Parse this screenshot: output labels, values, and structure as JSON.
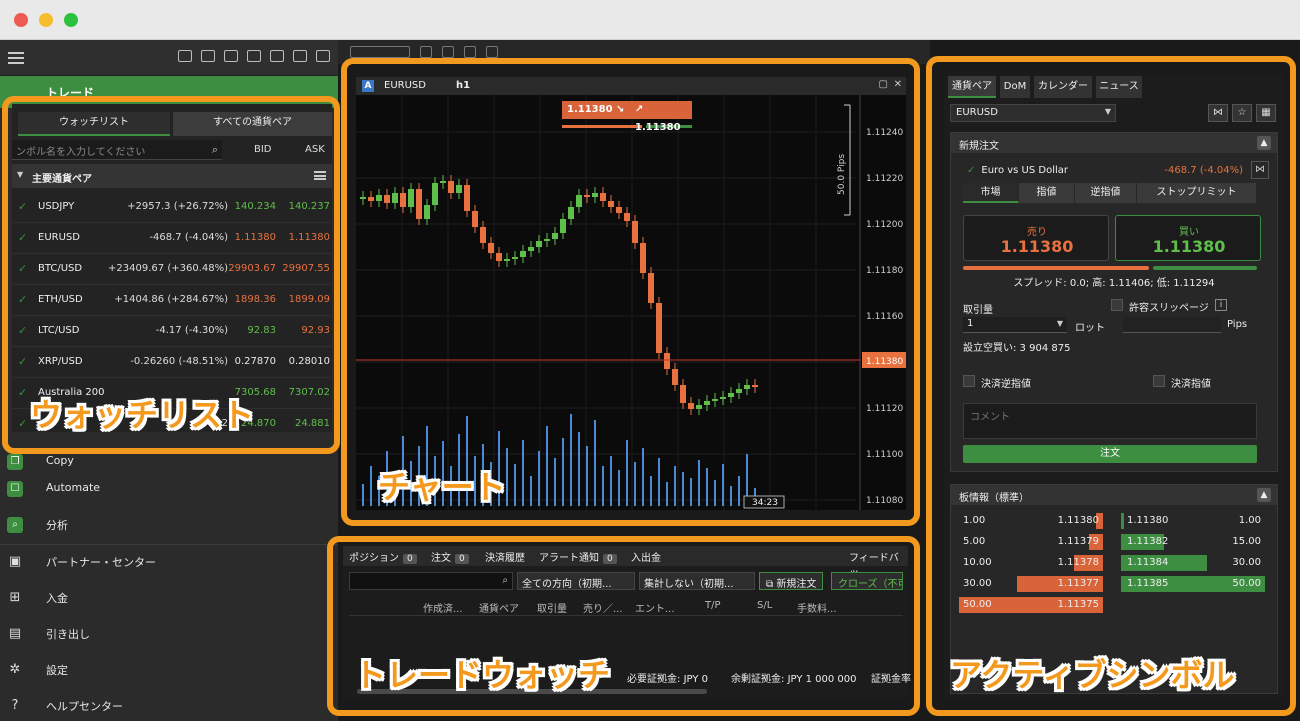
{
  "sidebar": {
    "trade_label": "トレード",
    "nav": [
      {
        "label": "Copy",
        "icon": "copy-icon"
      },
      {
        "label": "Automate",
        "icon": "robot-icon"
      },
      {
        "label": "分析",
        "icon": "analysis-icon"
      },
      {
        "label": "パートナー・センター",
        "icon": "briefcase-icon"
      },
      {
        "label": "入金",
        "icon": "deposit-icon"
      },
      {
        "label": "引き出し",
        "icon": "wallet-icon"
      },
      {
        "label": "設定",
        "icon": "gear-icon"
      },
      {
        "label": "ヘルプセンター",
        "icon": "help-icon"
      }
    ]
  },
  "watchlist": {
    "tab_watch": "ウォッチリスト",
    "tab_all": "すべての通貨ペア",
    "search_placeholder": "ンボル名を入力してください",
    "col_bid": "BID",
    "col_ask": "ASK",
    "group": "主要通貨ペア",
    "rows": [
      {
        "sym": "USDJPY",
        "chg": "+2957.3 (+26.72%)",
        "bid": "140.234",
        "ask": "140.237"
      },
      {
        "sym": "EURUSD",
        "chg": "-468.7 (-4.04%)",
        "bid": "1.11380",
        "ask": "1.11380"
      },
      {
        "sym": "BTC/USD",
        "chg": "+23409.67 (+360.48%)",
        "bid": "29903.67",
        "ask": "29907.55"
      },
      {
        "sym": "ETH/USD",
        "chg": "+1404.86 (+284.67%)",
        "bid": "1898.36",
        "ask": "1899.09"
      },
      {
        "sym": "LTC/USD",
        "chg": "-4.17 (-4.30%)",
        "bid": "92.83",
        "ask": "92.93"
      },
      {
        "sym": "XRP/USD",
        "chg": "-0.26260 (-48.51%)",
        "bid": "0.27870",
        "ask": "0.28010"
      },
      {
        "sym": "Australia 200",
        "chg": "",
        "bid": "7305.68",
        "ask": "7307.02"
      },
      {
        "sym": "",
        "chg": "+832",
        "bid": "24.870",
        "ask": "24.881"
      }
    ],
    "callout": "ウォッチリスト"
  },
  "chart": {
    "symbol": "EURUSD",
    "timeframe": "h1",
    "sell_quote": "1.11380",
    "buy_quote": "1.11380",
    "pips_label": "50.0 Pips",
    "current_price": "1.11380",
    "time_label": "34:23",
    "price_ticks": [
      "1.11240",
      "1.11220",
      "1.11200",
      "1.11180",
      "1.11160",
      "1.11140",
      "1.11120",
      "1.11100",
      "1.11080"
    ],
    "callout": "チャート",
    "colors": {
      "up": "#5fbf4a",
      "down": "#e8713f",
      "volume": "#4a8ad8"
    }
  },
  "tradewatch": {
    "tabs": [
      {
        "label": "ポジション",
        "count": "0"
      },
      {
        "label": "注文",
        "count": "0"
      },
      {
        "label": "決済履歴",
        "count": ""
      },
      {
        "label": "アラート通知",
        "count": "0"
      },
      {
        "label": "入出金",
        "count": ""
      }
    ],
    "feedback": "フィードバッ",
    "dir_select": "全ての方向（初期...",
    "agg_select": "集計しない（初期...",
    "new_order": "新規注文",
    "close_label": "クローズ（不可",
    "columns": [
      "作成済...",
      "通貨ペア",
      "取引量",
      "売り／...",
      "エント...",
      "T/P",
      "S/L",
      "手数料..."
    ],
    "footer": [
      {
        "label": "",
        "value": "000"
      },
      {
        "label": "必要証拠金:",
        "value": "JPY 0"
      },
      {
        "label": "余剰証拠金:",
        "value": "JPY 1 000 000"
      },
      {
        "label": "証拠金率",
        "value": ""
      }
    ],
    "callout": "トレードウォッチ"
  },
  "active": {
    "tabs": [
      "通貨ペア",
      "DoM",
      "カレンダー",
      "ニュース"
    ],
    "symbol": "EURUSD",
    "new_order_title": "新規注文",
    "pair_name": "Euro vs US Dollar",
    "pair_change": "-468.7 (-4.04%)",
    "order_tabs": [
      "市場",
      "指値",
      "逆指値",
      "ストップリミット"
    ],
    "sell_label": "売り",
    "sell_price": "1.11380",
    "buy_label": "買い",
    "buy_price": "1.11380",
    "spread": "スプレッド: 0.0; 高: 1.11406; 低: 1.11294",
    "volume_label": "取引量",
    "slippage_label": "許容スリッページ",
    "volume_value": "1",
    "lot_label": "ロット",
    "pips_label": "Pips",
    "margin_label": "設立空買い: 3 904 875",
    "sl_label": "決済逆指値",
    "tp_label": "決済指値",
    "comment_placeholder": "コメント",
    "order_button": "注文",
    "dom_title": "板情報（標準）",
    "dom_sell": [
      {
        "q": "1.00",
        "p": "1.11380",
        "fill": 0.05
      },
      {
        "q": "5.00",
        "p": "1.11379",
        "fill": 0.1
      },
      {
        "q": "10.00",
        "p": "1.11378",
        "fill": 0.2
      },
      {
        "q": "30.00",
        "p": "1.11377",
        "fill": 0.6
      },
      {
        "q": "50.00",
        "p": "1.11375",
        "fill": 1.0
      }
    ],
    "dom_buy": [
      {
        "p": "1.11380",
        "q": "1.00",
        "fill": 0.02
      },
      {
        "p": "1.11382",
        "q": "15.00",
        "fill": 0.3
      },
      {
        "p": "1.11384",
        "q": "30.00",
        "fill": 0.6
      },
      {
        "p": "1.11385",
        "q": "50.00",
        "fill": 1.0
      }
    ],
    "callout": "アクティブシンボル"
  }
}
